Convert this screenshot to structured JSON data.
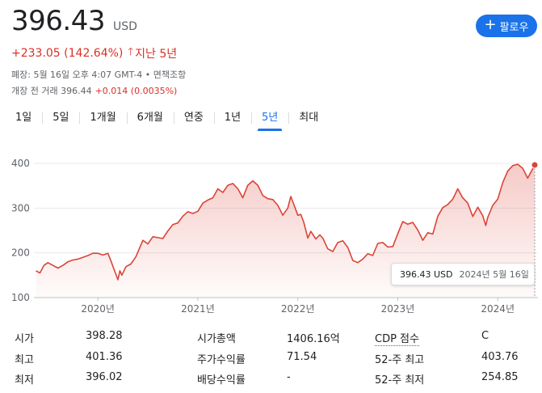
{
  "quote": {
    "price": "396.43",
    "currency": "USD",
    "change_text": "+233.05 (142.64%)",
    "period_text": "지난 5년",
    "market_status": "폐장: 5월 16일 오후 4:07 GMT-4 • 면책조항",
    "premarket_label": "개장 전 거래 396.44",
    "premarket_change": "+0.014 (0.0035%)"
  },
  "follow_button": {
    "label": "팔로우",
    "icon": "plus-icon"
  },
  "tabs": [
    {
      "label": "1일"
    },
    {
      "label": "5일"
    },
    {
      "label": "1개월"
    },
    {
      "label": "6개월"
    },
    {
      "label": "연중"
    },
    {
      "label": "1년"
    },
    {
      "label": "5년",
      "active": true
    },
    {
      "label": "최대"
    }
  ],
  "tooltip": {
    "value": "396.43 USD",
    "date": "2024년 5월 16일"
  },
  "colors": {
    "line": "#db4437",
    "accent": "#1a73e8",
    "negative": "#d93025"
  },
  "chart_data": {
    "type": "area",
    "y_ticks": [
      "400",
      "300",
      "200",
      "100"
    ],
    "x_ticks": [
      "2020년",
      "2021년",
      "2022년",
      "2023년",
      "2024년"
    ],
    "ylim": [
      100,
      400
    ],
    "xlim": [
      2019.36,
      2024.37
    ],
    "grid": true,
    "series": [
      {
        "x": [
          2019.38,
          2019.42,
          2019.46,
          2019.5,
          2019.55,
          2019.6,
          2019.65,
          2019.7,
          2019.75,
          2019.8,
          2019.85,
          2019.9,
          2019.95,
          2020.0,
          2020.05,
          2020.1,
          2020.13,
          2020.17,
          2020.2,
          2020.22,
          2020.24,
          2020.28,
          2020.33,
          2020.38,
          2020.45,
          2020.5,
          2020.55,
          2020.6,
          2020.65,
          2020.7,
          2020.75,
          2020.8,
          2020.85,
          2020.9,
          2020.95,
          2021.0,
          2021.05,
          2021.1,
          2021.15,
          2021.2,
          2021.25,
          2021.3,
          2021.35,
          2021.4,
          2021.45,
          2021.5,
          2021.55,
          2021.6,
          2021.65,
          2021.7,
          2021.75,
          2021.8,
          2021.85,
          2021.9,
          2021.93,
          2021.96,
          2022.0,
          2022.03,
          2022.06,
          2022.1,
          2022.13,
          2022.18,
          2022.22,
          2022.25,
          2022.3,
          2022.35,
          2022.4,
          2022.45,
          2022.5,
          2022.55,
          2022.6,
          2022.65,
          2022.7,
          2022.75,
          2022.8,
          2022.85,
          2022.9,
          2022.95,
          2023.0,
          2023.05,
          2023.1,
          2023.15,
          2023.2,
          2023.25,
          2023.3,
          2023.35,
          2023.4,
          2023.45,
          2023.5,
          2023.55,
          2023.6,
          2023.65,
          2023.7,
          2023.75,
          2023.8,
          2023.85,
          2023.88,
          2023.9,
          2023.95,
          2024.0,
          2024.05,
          2024.1,
          2024.15,
          2024.2,
          2024.25,
          2024.3,
          2024.37
        ],
        "y": [
          160,
          155,
          172,
          178,
          172,
          166,
          172,
          180,
          184,
          186,
          190,
          194,
          199,
          199,
          195,
          199,
          182,
          158,
          140,
          160,
          150,
          169,
          175,
          191,
          228,
          220,
          236,
          234,
          232,
          249,
          263,
          267,
          282,
          292,
          288,
          293,
          311,
          318,
          323,
          343,
          335,
          351,
          355,
          343,
          323,
          351,
          361,
          351,
          328,
          321,
          319,
          306,
          284,
          300,
          326,
          308,
          284,
          286,
          268,
          233,
          248,
          231,
          240,
          233,
          209,
          203,
          223,
          227,
          212,
          183,
          178,
          186,
          198,
          194,
          221,
          223,
          213,
          214,
          243,
          270,
          264,
          268,
          251,
          228,
          245,
          242,
          282,
          301,
          308,
          320,
          343,
          323,
          311,
          281,
          302,
          283,
          261,
          279,
          306,
          320,
          357,
          383,
          395,
          398,
          389,
          367,
          396.43
        ]
      }
    ]
  },
  "stats": {
    "rows": [
      [
        "시가",
        "398.28",
        "시가총액",
        "1406.16억",
        "CDP 점수",
        "C"
      ],
      [
        "최고",
        "401.36",
        "주가수익률",
        "71.54",
        "52-주 최고",
        "403.76"
      ],
      [
        "최저",
        "396.02",
        "배당수익률",
        "-",
        "52-주 최저",
        "254.85"
      ]
    ]
  }
}
